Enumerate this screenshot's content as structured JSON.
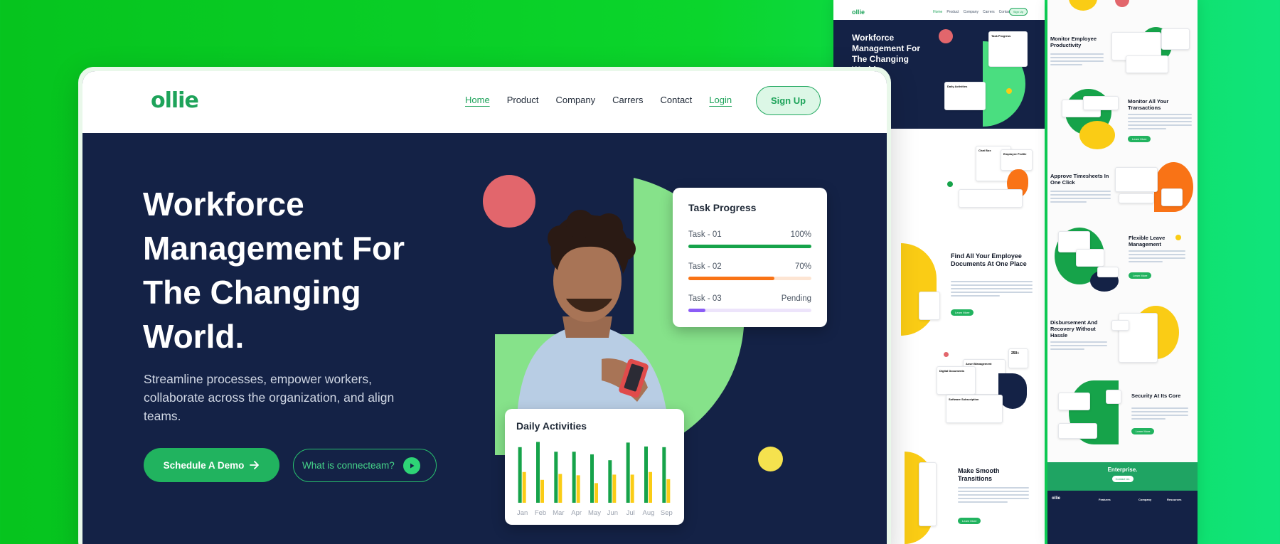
{
  "brand": {
    "logo": "ollie",
    "accent": "#1ea35a",
    "navy": "#142246",
    "background_green": "#0bd52c"
  },
  "nav": {
    "links": [
      "Home",
      "Product",
      "Company",
      "Carrers",
      "Contact"
    ],
    "login": "Login",
    "signup": "Sign Up"
  },
  "hero": {
    "title": "Workforce Management For The Changing World.",
    "subtitle": "Streamline processes, empower workers, collaborate across the organization, and align teams.",
    "cta_primary": "Schedule A Demo",
    "cta_secondary": "What is connecteam?"
  },
  "task_progress": {
    "title": "Task Progress",
    "tasks": [
      {
        "name": "Task - 01",
        "status": "100%",
        "progress": 1.0,
        "color": "#16a34a",
        "track": "#dcfce7"
      },
      {
        "name": "Task - 02",
        "status": "70%",
        "progress": 0.7,
        "color": "#f97316",
        "track": "#fde5d3"
      },
      {
        "name": "Task - 03",
        "status": "Pending",
        "progress": 0.14,
        "color": "#8b5cf6",
        "track": "#ede4fb"
      }
    ]
  },
  "chart_data": {
    "type": "bar",
    "title": "Daily Activities",
    "categories": [
      "Jan",
      "Feb",
      "Mar",
      "Apr",
      "May",
      "Jun",
      "Jul",
      "Aug",
      "Sep"
    ],
    "series": [
      {
        "color": "#16a34a",
        "values": [
          0.85,
          0.93,
          0.78,
          0.78,
          0.74,
          0.65,
          0.92,
          0.86,
          0.85
        ]
      },
      {
        "color": "#facc15",
        "values": [
          0.47,
          0.35,
          0.44,
          0.42,
          0.3,
          0.43,
          0.43,
          0.47,
          0.36
        ]
      }
    ],
    "ylim": [
      0,
      1
    ]
  },
  "preview_left": {
    "hero_title": "Workforce Management For The Changing World.",
    "sections": [
      "Find All Your Employee Documents At One Place",
      "Make Smooth Transitions"
    ],
    "cards": [
      "Task Progress",
      "Daily Activities",
      "Chat Box",
      "Employee Profile",
      "Asset Management",
      "Digital Documents",
      "Software Subscription",
      "250+"
    ],
    "button": "Learn More"
  },
  "preview_right": {
    "sections": [
      "Monitor Employee Productivity",
      "Monitor All Your Transactions",
      "Approve Timesheets In One Click",
      "Flexible Leave Management",
      "Disbursement And Recovery Without Hassle",
      "Security At Its Core"
    ],
    "cta_band": "Enterprise.",
    "cta_button": "Contact Us",
    "footer_logo": "ollie",
    "footer_cols": [
      "Features",
      "Company",
      "Resources"
    ]
  }
}
